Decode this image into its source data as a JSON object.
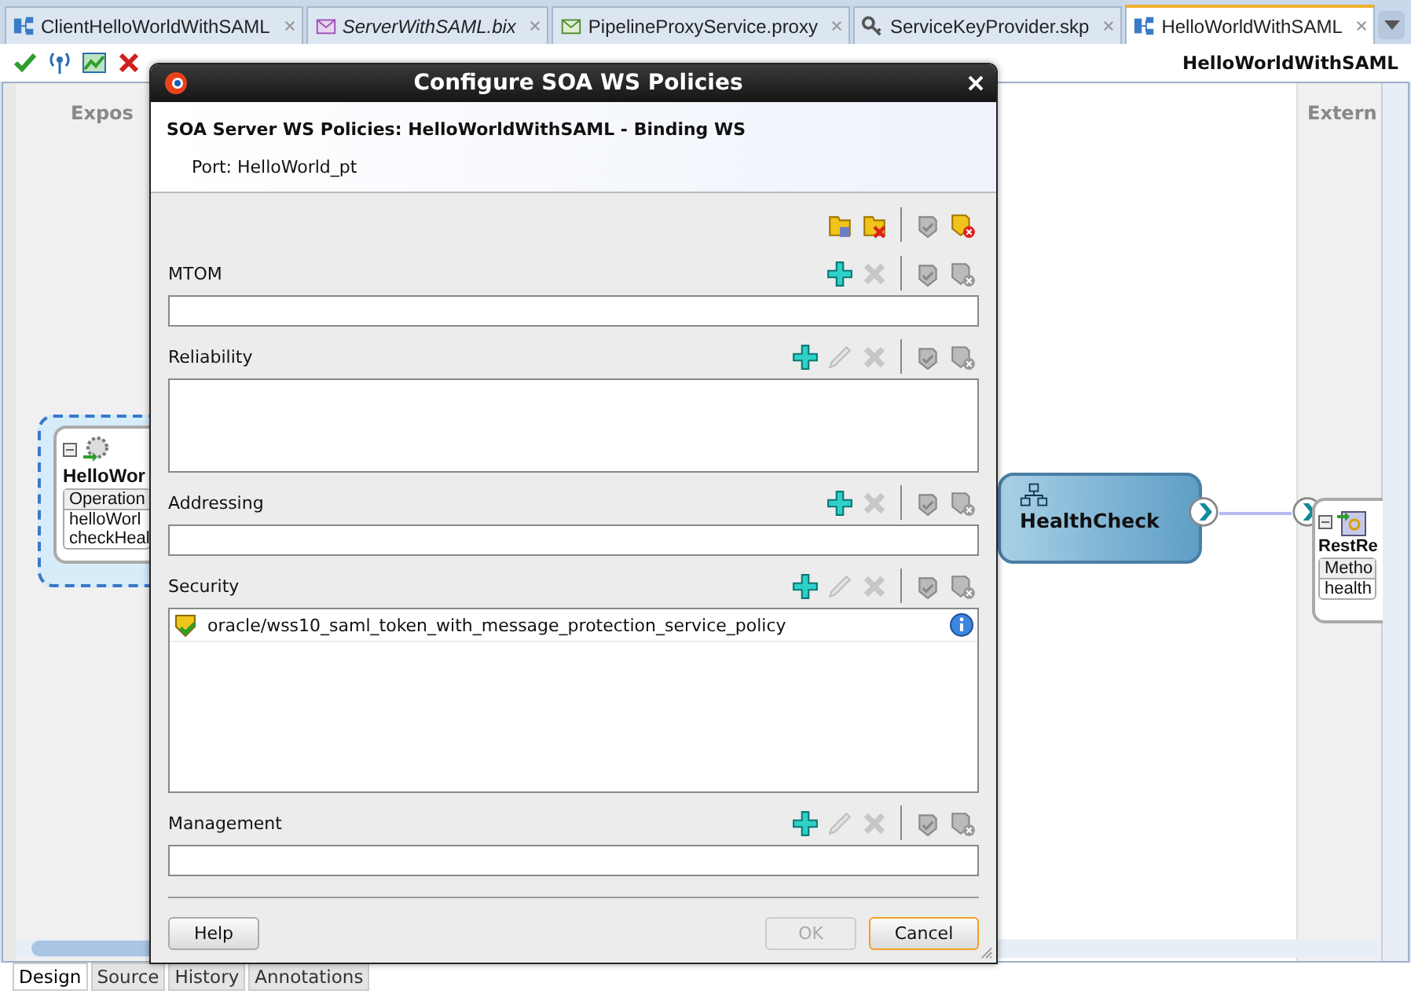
{
  "editor_tabs": [
    {
      "label": "ClientHelloWorldWithSAML",
      "kind": "composite",
      "italic": false,
      "selected": false
    },
    {
      "label": "ServerWithSAML.bix",
      "kind": "binding",
      "italic": true,
      "selected": false
    },
    {
      "label": "PipelineProxyService.proxy",
      "kind": "proxy",
      "italic": false,
      "selected": false
    },
    {
      "label": "ServiceKeyProvider.skp",
      "kind": "key",
      "italic": false,
      "selected": false
    },
    {
      "label": "HelloWorldWithSAML",
      "kind": "composite",
      "italic": false,
      "selected": true
    }
  ],
  "toolbar": {
    "title": "HelloWorldWithSAML"
  },
  "canvas": {
    "left_lane": "Expos",
    "right_lane": "Extern",
    "service": {
      "name": "HelloWor",
      "header": "Operation",
      "rows": [
        "helloWorl",
        "checkHeal"
      ]
    },
    "component": {
      "name": "HealthCheck"
    },
    "reference": {
      "name": "RestRe",
      "header": "Metho",
      "rows": [
        "health"
      ]
    }
  },
  "dialog": {
    "title": "Configure SOA WS Policies",
    "heading": "SOA Server WS Policies: HelloWorldWithSAML - Binding WS",
    "port": "Port: HelloWorld_pt",
    "sections": [
      {
        "label": "MTOM",
        "kind": "single",
        "actions": [
          {
            "kind": "add",
            "disabled": false
          },
          {
            "kind": "delete",
            "disabled": true
          }
        ]
      },
      {
        "label": "Reliability",
        "kind": "multi",
        "actions": [
          {
            "kind": "add",
            "disabled": false
          },
          {
            "kind": "edit",
            "disabled": true
          },
          {
            "kind": "delete",
            "disabled": true
          }
        ]
      },
      {
        "label": "Addressing",
        "kind": "single",
        "actions": [
          {
            "kind": "add",
            "disabled": false
          },
          {
            "kind": "delete",
            "disabled": true
          }
        ]
      },
      {
        "label": "Security",
        "kind": "tall",
        "actions": [
          {
            "kind": "add",
            "disabled": false
          },
          {
            "kind": "edit",
            "disabled": true
          },
          {
            "kind": "delete",
            "disabled": true
          }
        ],
        "policies": [
          {
            "name": "oracle/wss10_saml_token_with_message_protection_service_policy",
            "enabled": true
          }
        ]
      },
      {
        "label": "Management",
        "kind": "single",
        "actions": [
          {
            "kind": "add",
            "disabled": false
          },
          {
            "kind": "edit",
            "disabled": true
          },
          {
            "kind": "delete",
            "disabled": true
          }
        ]
      }
    ],
    "buttons": [
      {
        "label": "Help",
        "kind": "left",
        "disabled": false,
        "focused": false
      },
      {
        "label": "OK",
        "kind": "right",
        "disabled": true,
        "focused": false
      },
      {
        "label": "Cancel",
        "kind": "right",
        "disabled": false,
        "focused": true
      }
    ]
  },
  "bottom_tabs": [
    {
      "label": "Design",
      "selected": true
    },
    {
      "label": "Source",
      "selected": false
    },
    {
      "label": "History",
      "selected": false
    },
    {
      "label": "Annotations",
      "selected": false
    }
  ]
}
